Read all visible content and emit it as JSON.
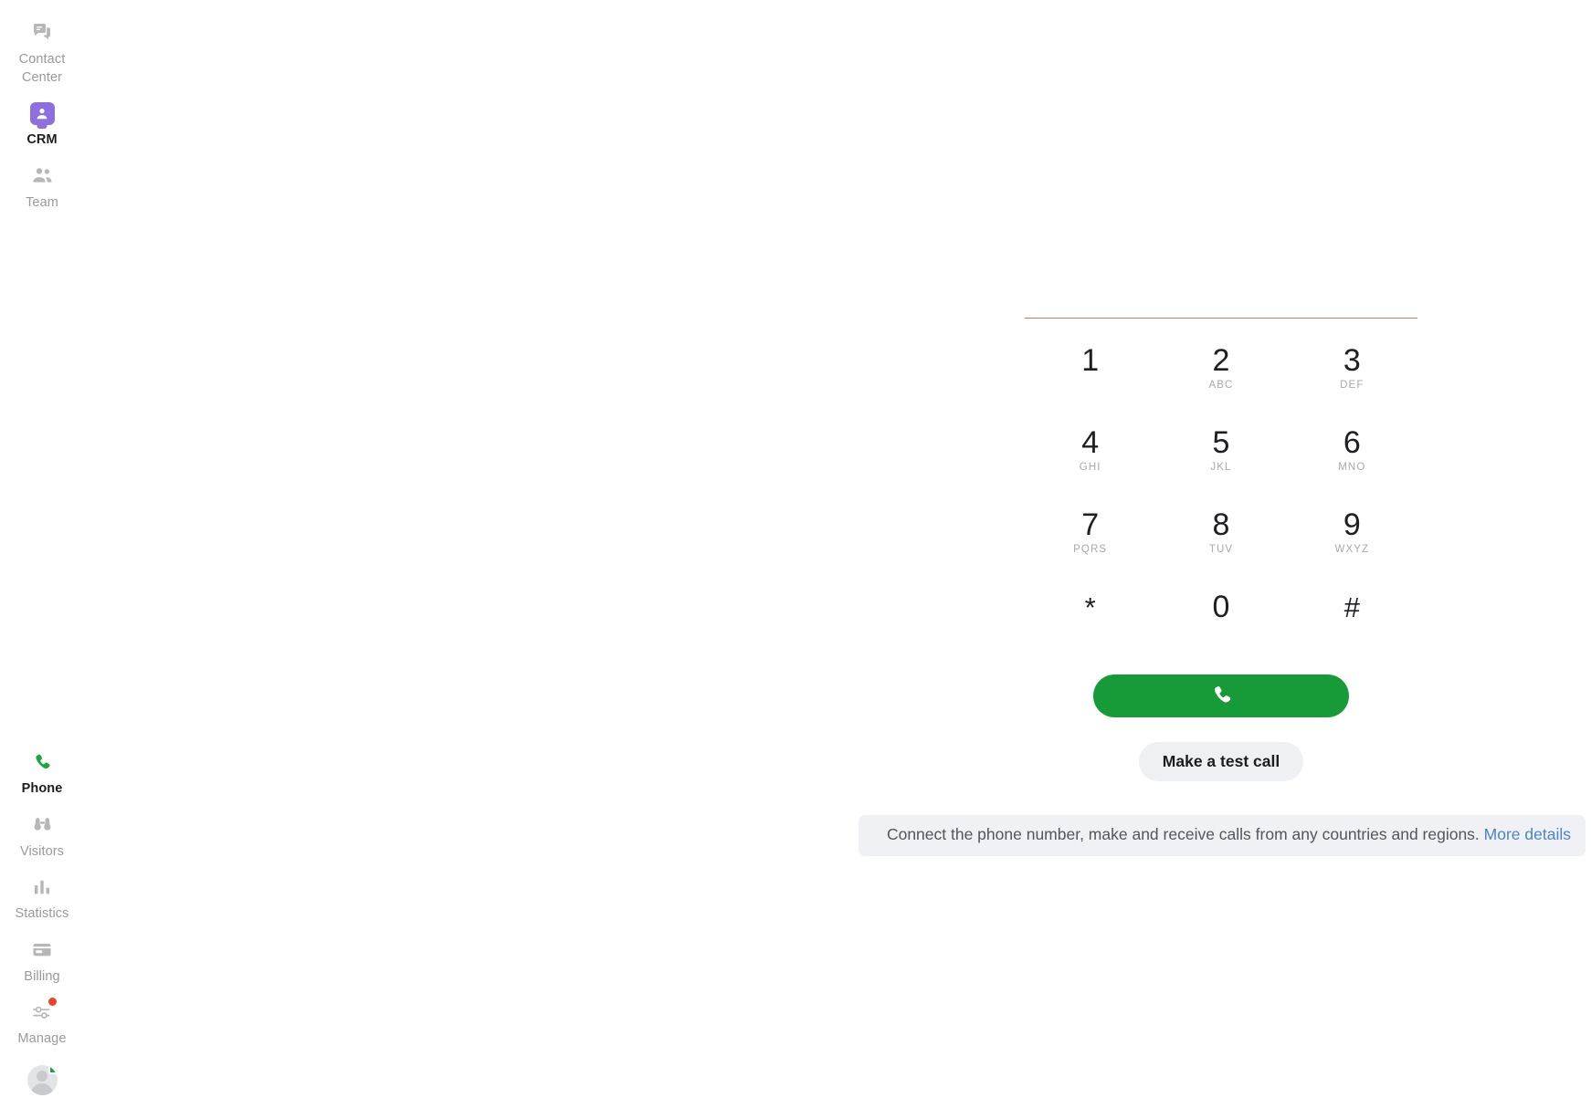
{
  "sidebar": {
    "top_items": [
      {
        "label": "Contact Center",
        "icon": "chat-bubble-icon",
        "active": false
      },
      {
        "label": "CRM",
        "icon": "crm-person-tile-icon",
        "active": true
      },
      {
        "label": "Team",
        "icon": "people-group-icon",
        "active": false
      }
    ],
    "bottom_items": [
      {
        "label": "Phone",
        "icon": "phone-handset-icon",
        "active": true,
        "badge": false
      },
      {
        "label": "Visitors",
        "icon": "binoculars-icon",
        "active": false,
        "badge": false
      },
      {
        "label": "Statistics",
        "icon": "bar-chart-icon",
        "active": false,
        "badge": false
      },
      {
        "label": "Billing",
        "icon": "credit-card-icon",
        "active": false,
        "badge": false
      },
      {
        "label": "Manage",
        "icon": "sliders-icon",
        "active": false,
        "badge": true
      }
    ],
    "avatar": {
      "name": "user-avatar",
      "status": "online"
    }
  },
  "dialer": {
    "number_value": "",
    "number_placeholder": "",
    "keys": [
      {
        "digit": "1",
        "letters": ""
      },
      {
        "digit": "2",
        "letters": "ABC"
      },
      {
        "digit": "3",
        "letters": "DEF"
      },
      {
        "digit": "4",
        "letters": "GHI"
      },
      {
        "digit": "5",
        "letters": "JKL"
      },
      {
        "digit": "6",
        "letters": "MNO"
      },
      {
        "digit": "7",
        "letters": "PQRS"
      },
      {
        "digit": "8",
        "letters": "TUV"
      },
      {
        "digit": "9",
        "letters": "WXYZ"
      },
      {
        "digit": "*",
        "letters": ""
      },
      {
        "digit": "0",
        "letters": ""
      },
      {
        "digit": "#",
        "letters": ""
      }
    ],
    "call_button_icon": "phone-handset-icon",
    "test_call_label": "Make a test call"
  },
  "info": {
    "text": "Connect the phone number, make and receive calls from any countries and regions.",
    "link_label": "More details"
  },
  "colors": {
    "call_green": "#169b38",
    "crm_purple": "#8d6fdd",
    "input_underline": "#bd7c70",
    "link_blue": "#4d84c4",
    "badge_red": "#f2402b",
    "status_green": "#18a33e",
    "info_bg": "#eff1f4"
  }
}
